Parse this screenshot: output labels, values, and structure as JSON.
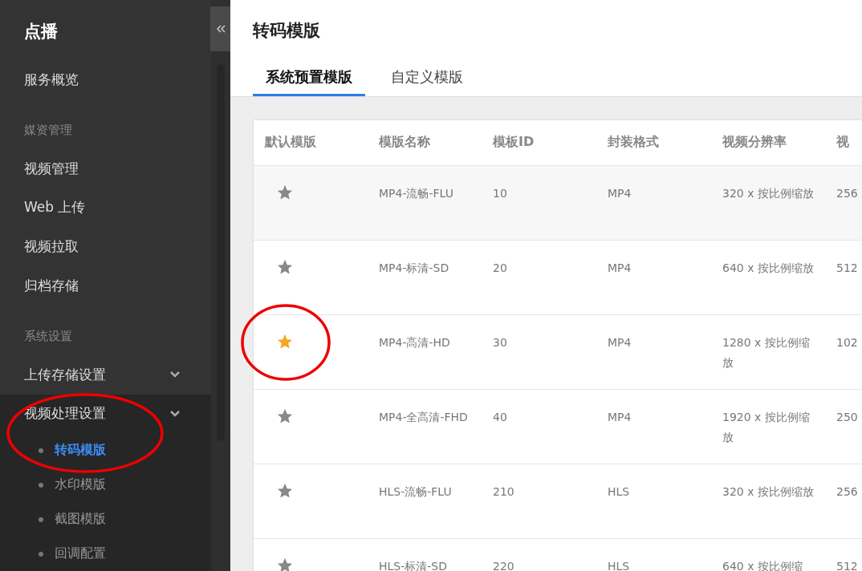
{
  "sidebar": {
    "title": "点播",
    "items": [
      {
        "kind": "item",
        "label": "服务概览"
      },
      {
        "kind": "group_label",
        "label": "媒资管理"
      },
      {
        "kind": "item",
        "label": "视频管理"
      },
      {
        "kind": "item",
        "label": "Web 上传"
      },
      {
        "kind": "item",
        "label": "视频拉取"
      },
      {
        "kind": "item",
        "label": "归档存储"
      },
      {
        "kind": "group_label",
        "label": "系统设置"
      },
      {
        "kind": "submenu",
        "label": "上传存储设置",
        "expanded": false,
        "highlight": false
      },
      {
        "kind": "submenu",
        "label": "视频处理设置",
        "expanded": true,
        "highlight": true,
        "children": [
          {
            "label": "转码模版",
            "selected": true
          },
          {
            "label": "水印模版",
            "selected": false
          },
          {
            "label": "截图模版",
            "selected": false
          },
          {
            "label": "回调配置",
            "selected": false
          }
        ]
      }
    ]
  },
  "page": {
    "title": "转码模版",
    "tabs": [
      {
        "label": "系统预置模版",
        "selected": true
      },
      {
        "label": "自定义模版",
        "selected": false
      }
    ]
  },
  "table": {
    "columns": [
      "默认模版",
      "模版名称",
      "模板ID",
      "封装格式",
      "视频分辨率",
      "视"
    ],
    "rows": [
      {
        "default": false,
        "name": "MP4-流畅-FLU",
        "id": "10",
        "format": "MP4",
        "resolution": "320 x 按比例缩放",
        "column_6": "256"
      },
      {
        "default": false,
        "name": "MP4-标清-SD",
        "id": "20",
        "format": "MP4",
        "resolution": "640 x 按比例缩放",
        "column_6": "512"
      },
      {
        "default": true,
        "highlight": true,
        "name": "MP4-高清-HD",
        "id": "30",
        "format": "MP4",
        "resolution": "1280 x 按比例缩放",
        "column_6": "102"
      },
      {
        "default": false,
        "name": "MP4-全高清-FHD",
        "id": "40",
        "format": "MP4",
        "resolution": "1920 x 按比例缩放",
        "column_6": "250"
      },
      {
        "default": false,
        "name": "HLS-流畅-FLU",
        "id": "210",
        "format": "HLS",
        "resolution": "320 x 按比例缩放",
        "column_6": "256"
      },
      {
        "default": false,
        "name": "HLS-标清-SD",
        "id": "220",
        "format": "HLS",
        "resolution": "640 x 按比例缩",
        "column_6": "512"
      }
    ]
  }
}
